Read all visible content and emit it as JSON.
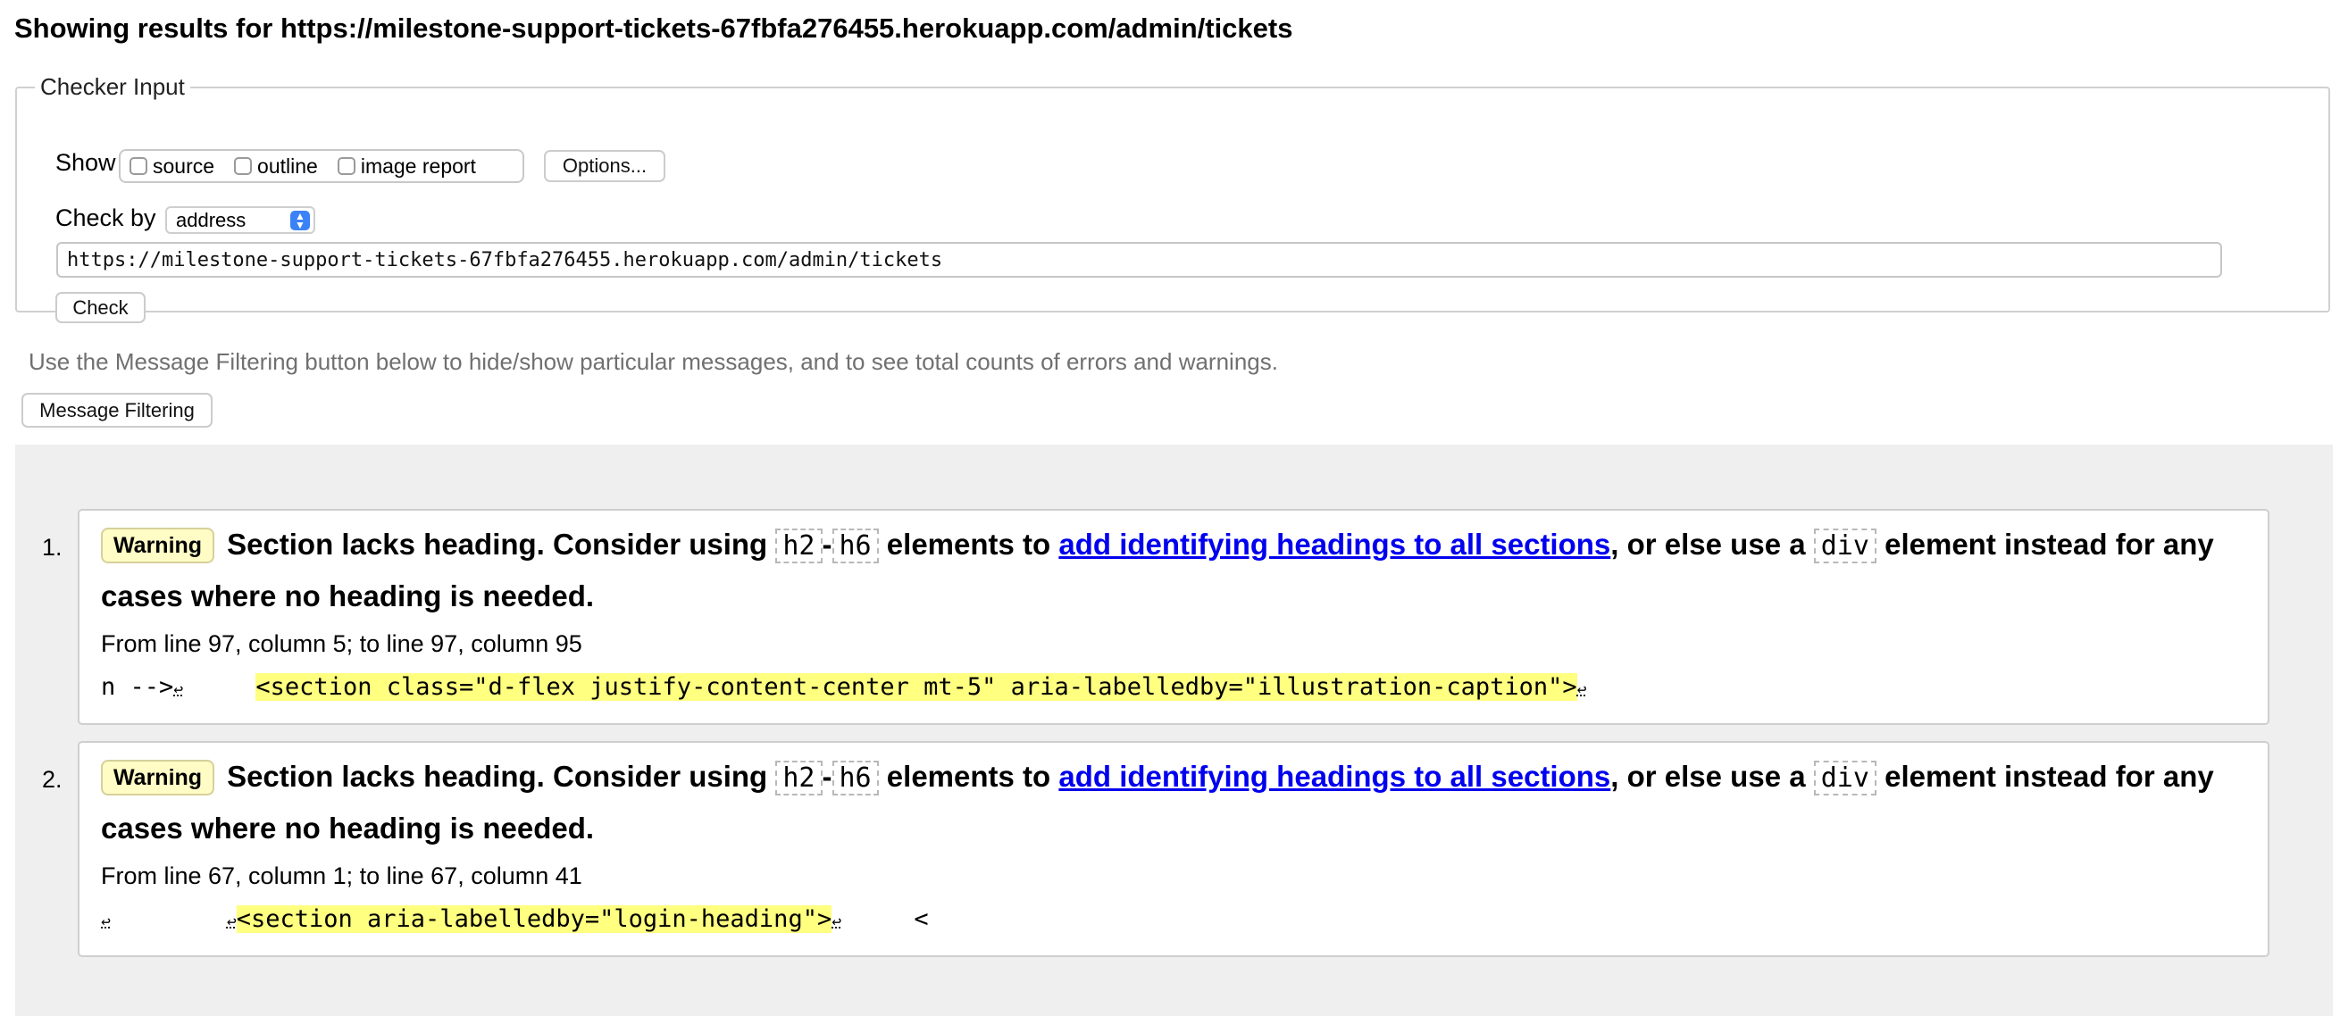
{
  "heading": "Showing results for https://milestone-support-tickets-67fbfa276455.herokuapp.com/admin/tickets",
  "checker": {
    "legend": "Checker Input",
    "show_label": "Show",
    "options": [
      "source",
      "outline",
      "image report"
    ],
    "options_button": "Options...",
    "check_by_label": "Check by",
    "check_by_value": "address",
    "url_value": "https://milestone-support-tickets-67fbfa276455.herokuapp.com/admin/tickets",
    "check_button": "Check"
  },
  "filter_note": "Use the Message Filtering button below to hide/show particular messages, and to see total counts of errors and warnings.",
  "filter_button": "Message Filtering",
  "messages": [
    {
      "number": "1.",
      "type": "Warning",
      "text_before": "Section lacks heading. Consider using ",
      "code_h2": "h2",
      "dash": "-",
      "code_h6": "h6",
      "text_middle": " elements to ",
      "link_text": "add identifying headings to all sections",
      "text_after": ", or else use a ",
      "code_div": "div",
      "text_end": " element instead for any cases where no heading is needed.",
      "location": "From line 97, column 5; to line 97, column 95",
      "extract_before": "n -->",
      "extract_gap": "     ",
      "extract_highlight": "<section class=\"d-flex justify-content-center mt-5\" aria-labelledby=\"illustration-caption\">",
      "extract_after": ""
    },
    {
      "number": "2.",
      "type": "Warning",
      "text_before": "Section lacks heading. Consider using ",
      "code_h2": "h2",
      "dash": "-",
      "code_h6": "h6",
      "text_middle": " elements to ",
      "link_text": "add identifying headings to all sections",
      "text_after": ", or else use a ",
      "code_div": "div",
      "text_end": " element instead for any cases where no heading is needed.",
      "location": "From line 67, column 1; to line 67, column 41",
      "extract_before": "",
      "extract_gap": "        ",
      "extract_highlight": "<section aria-labelledby=\"login-heading\">",
      "extract_after": "     <"
    }
  ],
  "icons": {
    "return": "↩",
    "select_arrows": "up-down-chevron-icon"
  },
  "colors": {
    "link": "#0000ee",
    "badge_bg": "#fffcc6",
    "highlight": "#ffff80",
    "results_bg": "#efefef"
  }
}
